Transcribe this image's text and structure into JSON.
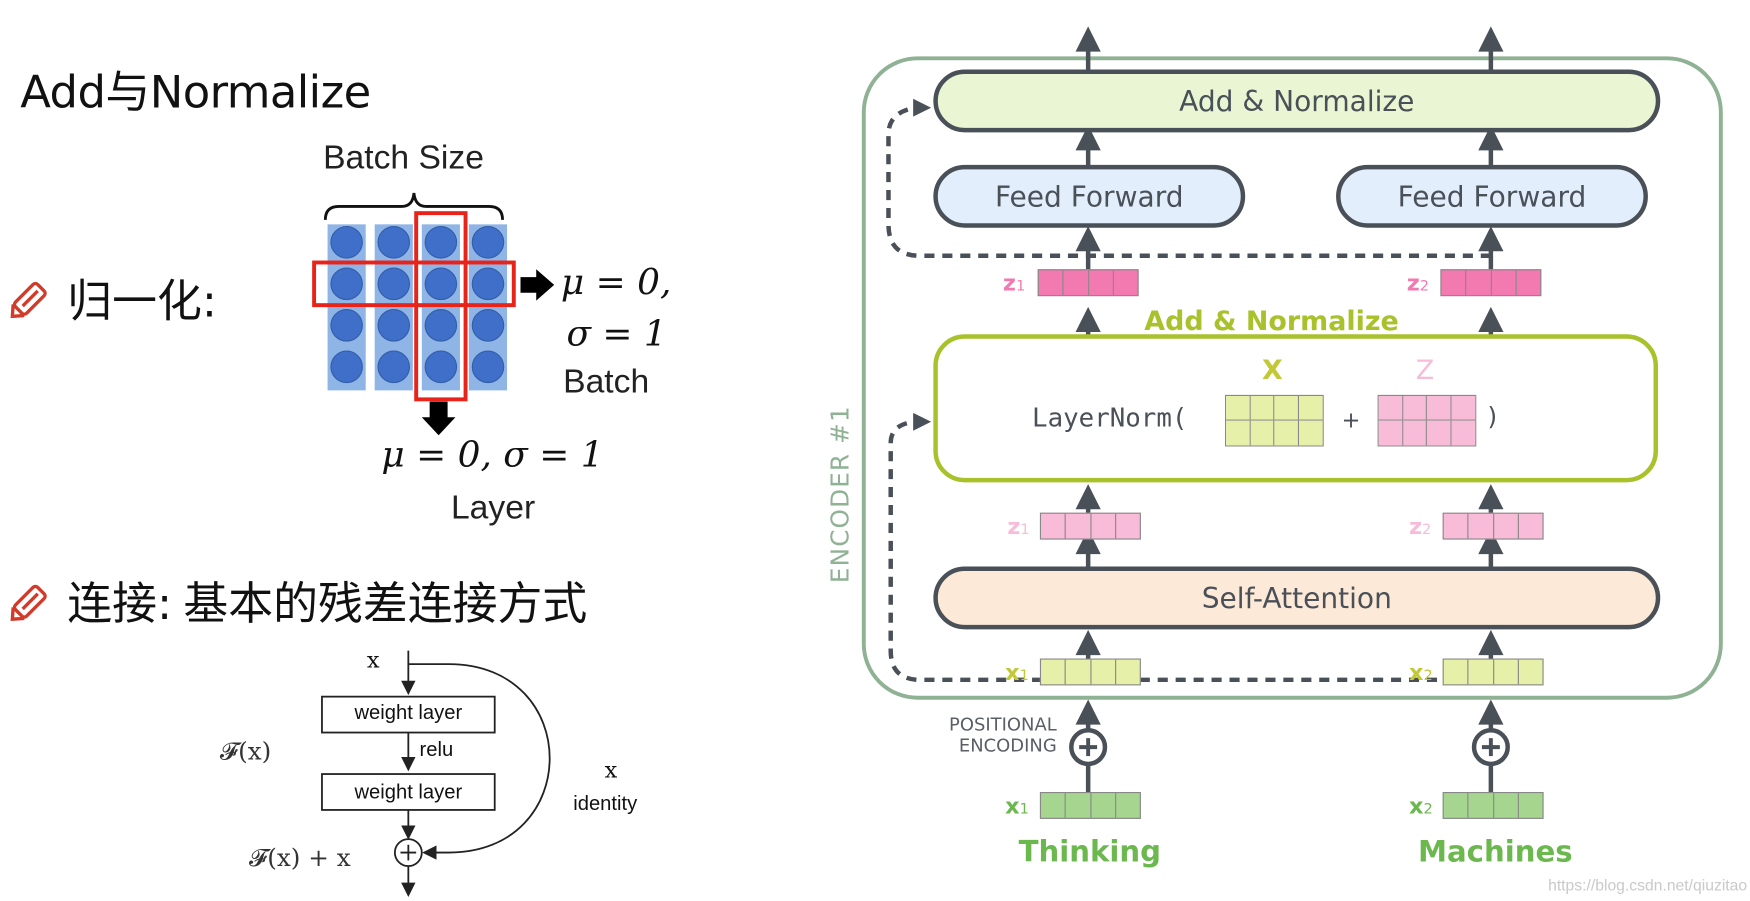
{
  "left": {
    "title": "Add与Normalize",
    "normalization": {
      "bullet_label": "归一化:",
      "batch_size_label": "Batch Size",
      "batch_stats": {
        "mu": "μ = 0,",
        "sigma": "σ = 1",
        "label": "Batch"
      },
      "layer_stats": {
        "text": "μ = 0, σ = 1",
        "label": "Layer"
      },
      "grid": {
        "rows": 4,
        "cols": 4,
        "highlight_row": 2,
        "highlight_col": 3
      }
    },
    "connection": {
      "bullet_label": "连接:",
      "bullet_text": "基本的残差连接方式"
    },
    "residual_block": {
      "input_label": "x",
      "layer1": "weight layer",
      "activation": "relu",
      "layer2": "weight layer",
      "fx_label": "𝓕(x)",
      "output_label": "𝓕(x) + x",
      "identity_x": "x",
      "identity_label": "identity"
    }
  },
  "right": {
    "encoder_label": "ENCODER #1",
    "top_add_normalize": "Add & Normalize",
    "feed_forward": [
      "Feed Forward",
      "Feed Forward"
    ],
    "z_out": [
      {
        "name": "z",
        "sub": "1"
      },
      {
        "name": "z",
        "sub": "2"
      }
    ],
    "mid_add_normalize_label": "Add & Normalize",
    "layernorm": {
      "func": "LayerNorm(",
      "x_label": "X",
      "plus": "+",
      "z_label": "Z",
      "close": ")"
    },
    "z_in": [
      {
        "name": "z",
        "sub": "1"
      },
      {
        "name": "z",
        "sub": "2"
      }
    ],
    "self_attention": "Self-Attention",
    "x_in": [
      {
        "name": "x",
        "sub": "1"
      },
      {
        "name": "x",
        "sub": "2"
      }
    ],
    "positional_encoding": [
      "POSITIONAL",
      "ENCODING"
    ],
    "x_embed": [
      {
        "name": "x",
        "sub": "1"
      },
      {
        "name": "x",
        "sub": "2"
      }
    ],
    "words": [
      "Thinking",
      "Machines"
    ],
    "colors": {
      "encoder_border": "#8fb295",
      "add_norm_fill": "#eaf5d3",
      "feed_forward_fill": "#e2eefb",
      "self_attention_fill": "#fde9d7",
      "layernorm_border": "#a9c12a",
      "layernorm_text": "#a9c12a",
      "z_dark": "#f27ab0",
      "z_light": "#f8bcd8",
      "x_light": "#e6f0a8",
      "x_label": "#c2c935",
      "x_embed": "#a6d58f",
      "word_green": "#6bb84f"
    }
  },
  "watermark": "https://blog.csdn.net/qiuzitao"
}
